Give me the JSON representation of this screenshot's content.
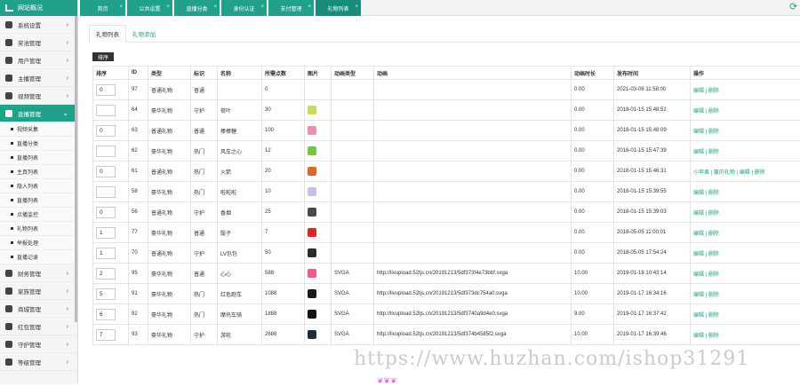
{
  "sidebar": {
    "header": "网站概况",
    "items": [
      {
        "label": "系统设置",
        "active": false
      },
      {
        "label": "奖池管理",
        "active": false
      },
      {
        "label": "用户管理",
        "active": false
      },
      {
        "label": "主播管理",
        "active": false
      },
      {
        "label": "视频管理",
        "active": false
      },
      {
        "label": "直播管理",
        "active": true
      }
    ],
    "subitems": [
      "视频采集",
      "直播分类",
      "直播列表",
      "主真列表",
      "隐入列表",
      "直播列表",
      "点播监控",
      "礼物列表",
      "举报处理",
      "直播记录"
    ],
    "bottom_items": [
      {
        "label": "财务管理"
      },
      {
        "label": "家族管理"
      },
      {
        "label": "商城管理"
      },
      {
        "label": "红包管理"
      },
      {
        "label": "守护管理"
      },
      {
        "label": "等级管理"
      }
    ]
  },
  "tabs": [
    "首页",
    "公共设置",
    "直播分类",
    "身份认证",
    "支付管理",
    "礼物列表"
  ],
  "subtabs": {
    "list": "礼物列表",
    "add": "礼物添加"
  },
  "sort_button": "排序",
  "columns": [
    "排序",
    "ID",
    "类型",
    "标识",
    "名称",
    "所需点数",
    "图片",
    "动画类型",
    "动画",
    "动画时长",
    "发布时间",
    "操作"
  ],
  "rows": [
    {
      "sort": "0",
      "id": "97",
      "type": "普通礼物",
      "mark": "普通",
      "name": "",
      "points": "0",
      "img": "",
      "anim_type": "",
      "anim": "",
      "duration": "0.00",
      "time": "2021-03-08 11:58:00",
      "ops": "编辑 | 删除"
    },
    {
      "sort": "",
      "id": "64",
      "type": "豪华礼物",
      "mark": "守护",
      "name": "荷叶",
      "points": "30",
      "img": "#c9d85e",
      "anim_type": "",
      "anim": "",
      "duration": "0.00",
      "time": "2018-01-15 15:48:52",
      "ops": "编辑 | 删除"
    },
    {
      "sort": "0",
      "id": "63",
      "type": "普通礼物",
      "mark": "普通",
      "name": "棒棒糖",
      "points": "100",
      "img": "#e88fb8",
      "anim_type": "",
      "anim": "",
      "duration": "0.00",
      "time": "2018-01-15 15:48:09",
      "ops": "编辑 | 删除"
    },
    {
      "sort": "",
      "id": "62",
      "type": "豪华礼物",
      "mark": "热门",
      "name": "风车之心",
      "points": "12",
      "img": "#79c24a",
      "anim_type": "",
      "anim": "",
      "duration": "0.00",
      "time": "2018-01-15 15:47:39",
      "ops": "编辑 | 删除"
    },
    {
      "sort": "0",
      "id": "61",
      "type": "普通礼物",
      "mark": "热门",
      "name": "火箭",
      "points": "20",
      "img": "#d9682a",
      "anim_type": "",
      "anim": "",
      "duration": "0.00",
      "time": "2018-01-15 15:46:31",
      "ops": "小苹果 | 赢的礼物 | 编辑 | 删除"
    },
    {
      "sort": "",
      "id": "58",
      "type": "豪华礼物",
      "mark": "热门",
      "name": "啦啦啦",
      "points": "10",
      "img": "#c9c0e6",
      "anim_type": "",
      "anim": "",
      "duration": "0.00",
      "time": "2018-01-15 15:39:55",
      "ops": "编辑 | 删除"
    },
    {
      "sort": "0",
      "id": "56",
      "type": "普通礼物",
      "mark": "守护",
      "name": "香烟",
      "points": "25",
      "img": "#4a4a4a",
      "anim_type": "",
      "anim": "",
      "duration": "0.00",
      "time": "2018-01-15 15:39:03",
      "ops": "编辑 | 删除"
    },
    {
      "sort": "1",
      "id": "77",
      "type": "豪华礼物",
      "mark": "普通",
      "name": "骰子",
      "points": "7",
      "img": "#d02a2a",
      "anim_type": "",
      "anim": "",
      "duration": "0.00",
      "time": "2018-05-05 11:00:01",
      "ops": "编辑 | 删除"
    },
    {
      "sort": "1",
      "id": "70",
      "type": "普通礼物",
      "mark": "守护",
      "name": "LV包包",
      "points": "50",
      "img": "#2b2b2b",
      "anim_type": "",
      "anim": "",
      "duration": "0.00",
      "time": "2018-05-05 17:54:24",
      "ops": "编辑 | 删除"
    },
    {
      "sort": "2",
      "id": "95",
      "type": "豪华礼物",
      "mark": "普通",
      "name": "心心",
      "points": "588",
      "img": "#ef5b8a",
      "anim_type": "SVGA",
      "anim": "http://livupload.52tjs.cn/20191213/5df373f4e73bbf.svga",
      "duration": "10.00",
      "time": "2019-01-18 10:43:14",
      "ops": "编辑 | 删除"
    },
    {
      "sort": "5",
      "id": "91",
      "type": "豪华礼物",
      "mark": "热门",
      "name": "红色跑车",
      "points": "1088",
      "img": "#1a1a1a",
      "anim_type": "SVGA",
      "anim": "http://livupload.52tjs.cn/20191213/5df373dc754a0.svga",
      "duration": "10.00",
      "time": "2019-01-17 16:34:16",
      "ops": "编辑 | 删除"
    },
    {
      "sort": "6",
      "id": "92",
      "type": "豪华礼物",
      "mark": "热门",
      "name": "摩托车骑",
      "points": "1888",
      "img": "#111111",
      "anim_type": "SVGA",
      "anim": "http://livupload.52tjs.cn/20191213/5df3740a9d4e0.svga",
      "duration": "9.00",
      "time": "2019-01-17 16:37:42",
      "ops": "编辑 | 删除"
    },
    {
      "sort": "7",
      "id": "93",
      "type": "豪华礼物",
      "mark": "守护",
      "name": "游轮",
      "points": "2688",
      "img": "#1c2f3f",
      "anim_type": "SVGA",
      "anim": "http://livupload.52tjs.cn/20191213/5df374b4585f2.svga",
      "duration": "10.00",
      "time": "2019-01-17 16:39:46",
      "ops": "编辑 | 删除"
    }
  ],
  "watermark": "https://www.huzhan.com/ishop31291",
  "colors": {
    "accent": "#21a18a",
    "sidebar_bg": "#f5f5f5"
  }
}
